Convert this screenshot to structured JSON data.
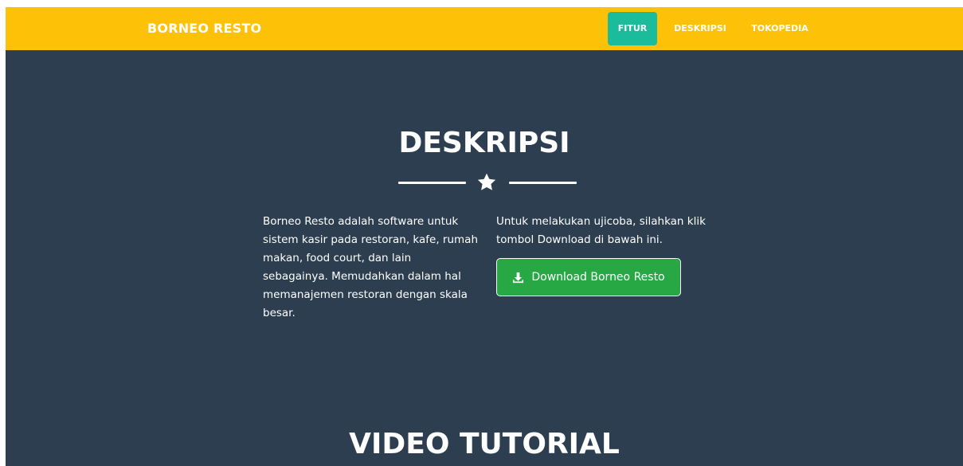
{
  "navbar": {
    "brand": "BORNEO RESTO",
    "items": [
      {
        "label": "FITUR",
        "active": true
      },
      {
        "label": "DESKRIPSI",
        "active": false
      },
      {
        "label": "TOKOPEDIA",
        "active": false
      }
    ]
  },
  "deskripsi": {
    "title": "DESKRIPSI",
    "divider_icon": "star-icon",
    "left_text": "Borneo Resto adalah software untuk sistem kasir pada restoran, kafe, rumah makan, food court, dan lain sebagainya. Memudahkan dalam hal memanajemen restoran dengan skala besar.",
    "right_text": "Untuk melakukan ujicoba, silahkan klik tombol Download di bawah ini.",
    "download_button": {
      "label": "Download Borneo Resto",
      "icon": "download-icon"
    }
  },
  "video": {
    "title": "VIDEO TUTORIAL"
  },
  "colors": {
    "navbar": "#fdc107",
    "active_nav": "#1abc9c",
    "section_bg": "#2c3e50",
    "button": "#28a745"
  }
}
